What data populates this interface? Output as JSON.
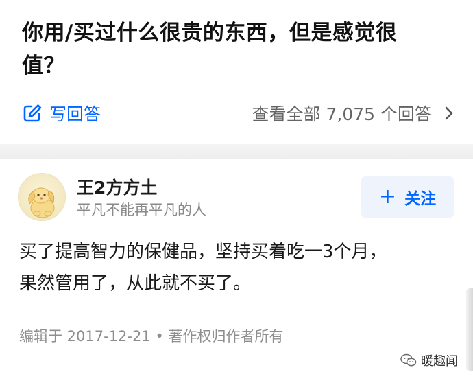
{
  "question": {
    "title_line1": "你用/买过什么很贵的东西，但是感觉很",
    "title_line2": "值？"
  },
  "actions": {
    "write_answer_label": "写回答",
    "view_all_label": "查看全部 7,075 个回答",
    "icons": {
      "write": "edit-pencil-icon",
      "view_all": "chevron-right-icon"
    },
    "accent_color": "#0066ff"
  },
  "answer": {
    "author": {
      "name": "王2方方土",
      "bio": "平凡不能再平凡的人",
      "avatar_icon": "cartoon-dog-avatar"
    },
    "follow_label": "关注",
    "follow_icon": "plus-icon",
    "body_line1": "买了提高智力的保健品，坚持买着吃一3个月，",
    "body_line2": "果然管用了，从此就不买了。",
    "meta": "编辑于 2017-12-21 • 著作权归作者所有"
  },
  "watermark": {
    "icon": "wechat-icon",
    "text": "暖趣闻"
  }
}
